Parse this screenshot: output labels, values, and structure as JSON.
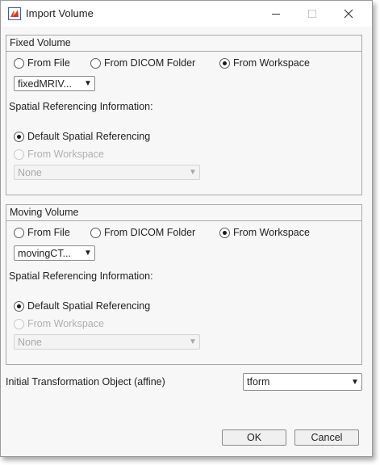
{
  "window": {
    "title": "Import Volume",
    "controls": {
      "minimize_icon": "minimize-icon",
      "maximize_icon": "maximize-icon",
      "close_icon": "close-icon"
    }
  },
  "fixed": {
    "panel_title": "Fixed Volume",
    "source_options": [
      "From File",
      "From DICOM Folder",
      "From Workspace"
    ],
    "selected_source": "From Workspace",
    "variable_value": "fixedMRIV...",
    "spatial_label": "Spatial Referencing Information:",
    "spatial_options": [
      "Default Spatial Referencing",
      "From Workspace"
    ],
    "spatial_selected": "Default Spatial Referencing",
    "spatial_dropdown_value": "None"
  },
  "moving": {
    "panel_title": "Moving Volume",
    "source_options": [
      "From File",
      "From DICOM Folder",
      "From Workspace"
    ],
    "selected_source": "From Workspace",
    "variable_value": "movingCT...",
    "spatial_label": "Spatial Referencing Information:",
    "spatial_options": [
      "Default Spatial Referencing",
      "From Workspace"
    ],
    "spatial_selected": "Default Spatial Referencing",
    "spatial_dropdown_value": "None"
  },
  "transform": {
    "label": "Initial Transformation Object (affine)",
    "value": "tform"
  },
  "buttons": {
    "ok": "OK",
    "cancel": "Cancel"
  },
  "colors": {
    "app_icon_red": "#d9382a",
    "app_icon_orange": "#f0a53a"
  }
}
